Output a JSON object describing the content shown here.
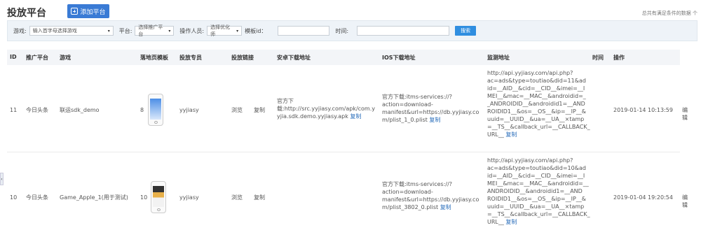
{
  "header": {
    "title": "投放平台",
    "add_button": "添加平台",
    "summary": "总共有满足条件的数据 个"
  },
  "filters": {
    "game_label": "游戏:",
    "game_placeholder": "输入首字母选择游戏",
    "platform_label": "平台:",
    "platform_value": "选择推广平台",
    "operator_label": "操作人员:",
    "operator_value": "选择优化师",
    "template_label": "模板id：",
    "time_label": "时间:",
    "search_button": "搜索"
  },
  "table": {
    "headers": [
      "ID",
      "推广平台",
      "游戏",
      "落地页模板",
      "投放专员",
      "投放链接",
      "安卓下载地址",
      "IOS下载地址",
      "监测地址",
      "时间",
      "操作"
    ],
    "rows": [
      {
        "id": "11",
        "platform": "今日头条",
        "game": "联运sdk_demo",
        "template_no": "8",
        "specialist": "yyjiasy",
        "browse": "浏览",
        "copy": "复制",
        "android": [
          "官方下",
          "载:http://src.yyjiasy.com/apk/com.y",
          "yjia.sdk.demo.yyjiasy.apk"
        ],
        "android_copy": "复制",
        "ios": [
          "官方下载:itms-services://?",
          "action=download-",
          "manifest&url=https://db.yyjiasy.co",
          "m/plist_1_0.plist"
        ],
        "ios_copy": "复制",
        "monitor": [
          "http://api.yyjiasy.com/api.php?",
          "ac=ads&type=toutiao&did=11&ad",
          "id=__AID__&cid=__CID__&imei=__I",
          "MEI__&mac=__MAC__&androidid=_",
          "_ANDROIDID__&androidid1=__AND",
          "ROIDID1__&os=__OS__&ip=__IP__&",
          "uuid=__UUID__&ua=__UA__×tamp",
          "=__TS__&callback_url=__CALLBACK_",
          "URL__"
        ],
        "monitor_copy": "复制",
        "time": "2019-01-14 10:13:59",
        "edit": "编辑"
      },
      {
        "id": "10",
        "platform": "今日头条",
        "game": "Game_Apple_1(用于测试)",
        "template_no": "10",
        "specialist": "yyjiasy",
        "browse": "浏览",
        "copy": "复制",
        "ios": [
          "官方下载:itms-services://?",
          "action=download-",
          "manifest&url=https://db.yyjiasy.co",
          "m/plist_3802_0.plist"
        ],
        "ios_copy": "复制",
        "monitor": [
          "http://api.yyjiasy.com/api.php?",
          "ac=ads&type=toutiao&did=10&ad",
          "id=__AID__&cid=__CID__&imei=__I",
          "MEI__&mac=__MAC__&androidid=__",
          "ANDROIDID__&androidid1=__AND",
          "ROIDID1__&os=__OS__&ip=__IP__&",
          "uuid=__UUID__&ua=__UA__×tamp",
          "=__TS__&callback_url=__CALLBACK_",
          "URL__"
        ],
        "monitor_copy": "复制",
        "time": "2019-01-04 19:20:54",
        "edit": "编辑"
      }
    ]
  },
  "colors": {
    "accent": "#3a7bd5",
    "link": "#2a6ebb",
    "filter_bg": "#eef3f8"
  },
  "icons": {
    "add": "plus-square-icon",
    "dropdown": "caret-down-icon",
    "side": "chevron-left-icon"
  }
}
